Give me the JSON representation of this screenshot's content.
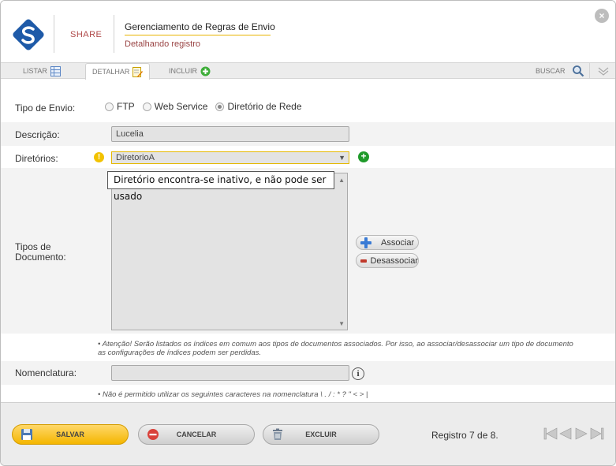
{
  "header": {
    "brand": "SHARE",
    "title": "Gerenciamento de Regras de Envio",
    "subtitle": "Detalhando registro",
    "close_glyph": "×"
  },
  "tabs": {
    "listar": "LISTAR",
    "detalhar": "DETALHAR",
    "incluir": "INCLUIR",
    "buscar": "BUSCAR"
  },
  "form": {
    "tipo_envio_label": "Tipo de Envio:",
    "options": [
      "FTP",
      "Web Service",
      "Diretório de Rede"
    ],
    "selected_option": "Diretório de Rede",
    "descricao_label": "Descrição:",
    "descricao_value": "Lucelia",
    "diretorios_label": "Diretórios:",
    "diretorios_value": "DiretorioA",
    "tooltip": "Diretório encontra-se inativo, e não pode ser usado",
    "tipos_label_1": "Tipos de",
    "tipos_label_2": "Documento:",
    "associar": "Associar",
    "desassociar": "Desassociar",
    "note_1_a": "•  Atenção! Serão listados os índices em comum aos tipos de documentos associados. Por isso, ao associar/desassociar um tipo de documento",
    "note_1_b": "as configurações de índices podem ser perdidas.",
    "nomenclatura_label": "Nomenclatura:",
    "nomenclatura_value": "",
    "note_2": "•  Não é permitido utilizar os seguintes caracteres na nomenclatura \\ . / : * ? \" < > |"
  },
  "footer": {
    "salvar": "SALVAR",
    "cancelar": "CANCELAR",
    "excluir": "EXCLUIR",
    "registro": "Registro 7 de 8."
  },
  "colors": {
    "accent_yellow": "#f4b600",
    "brand_red": "#b04a4a",
    "add_green": "#1f9a2a",
    "logo_blue": "#1e5aa8"
  }
}
